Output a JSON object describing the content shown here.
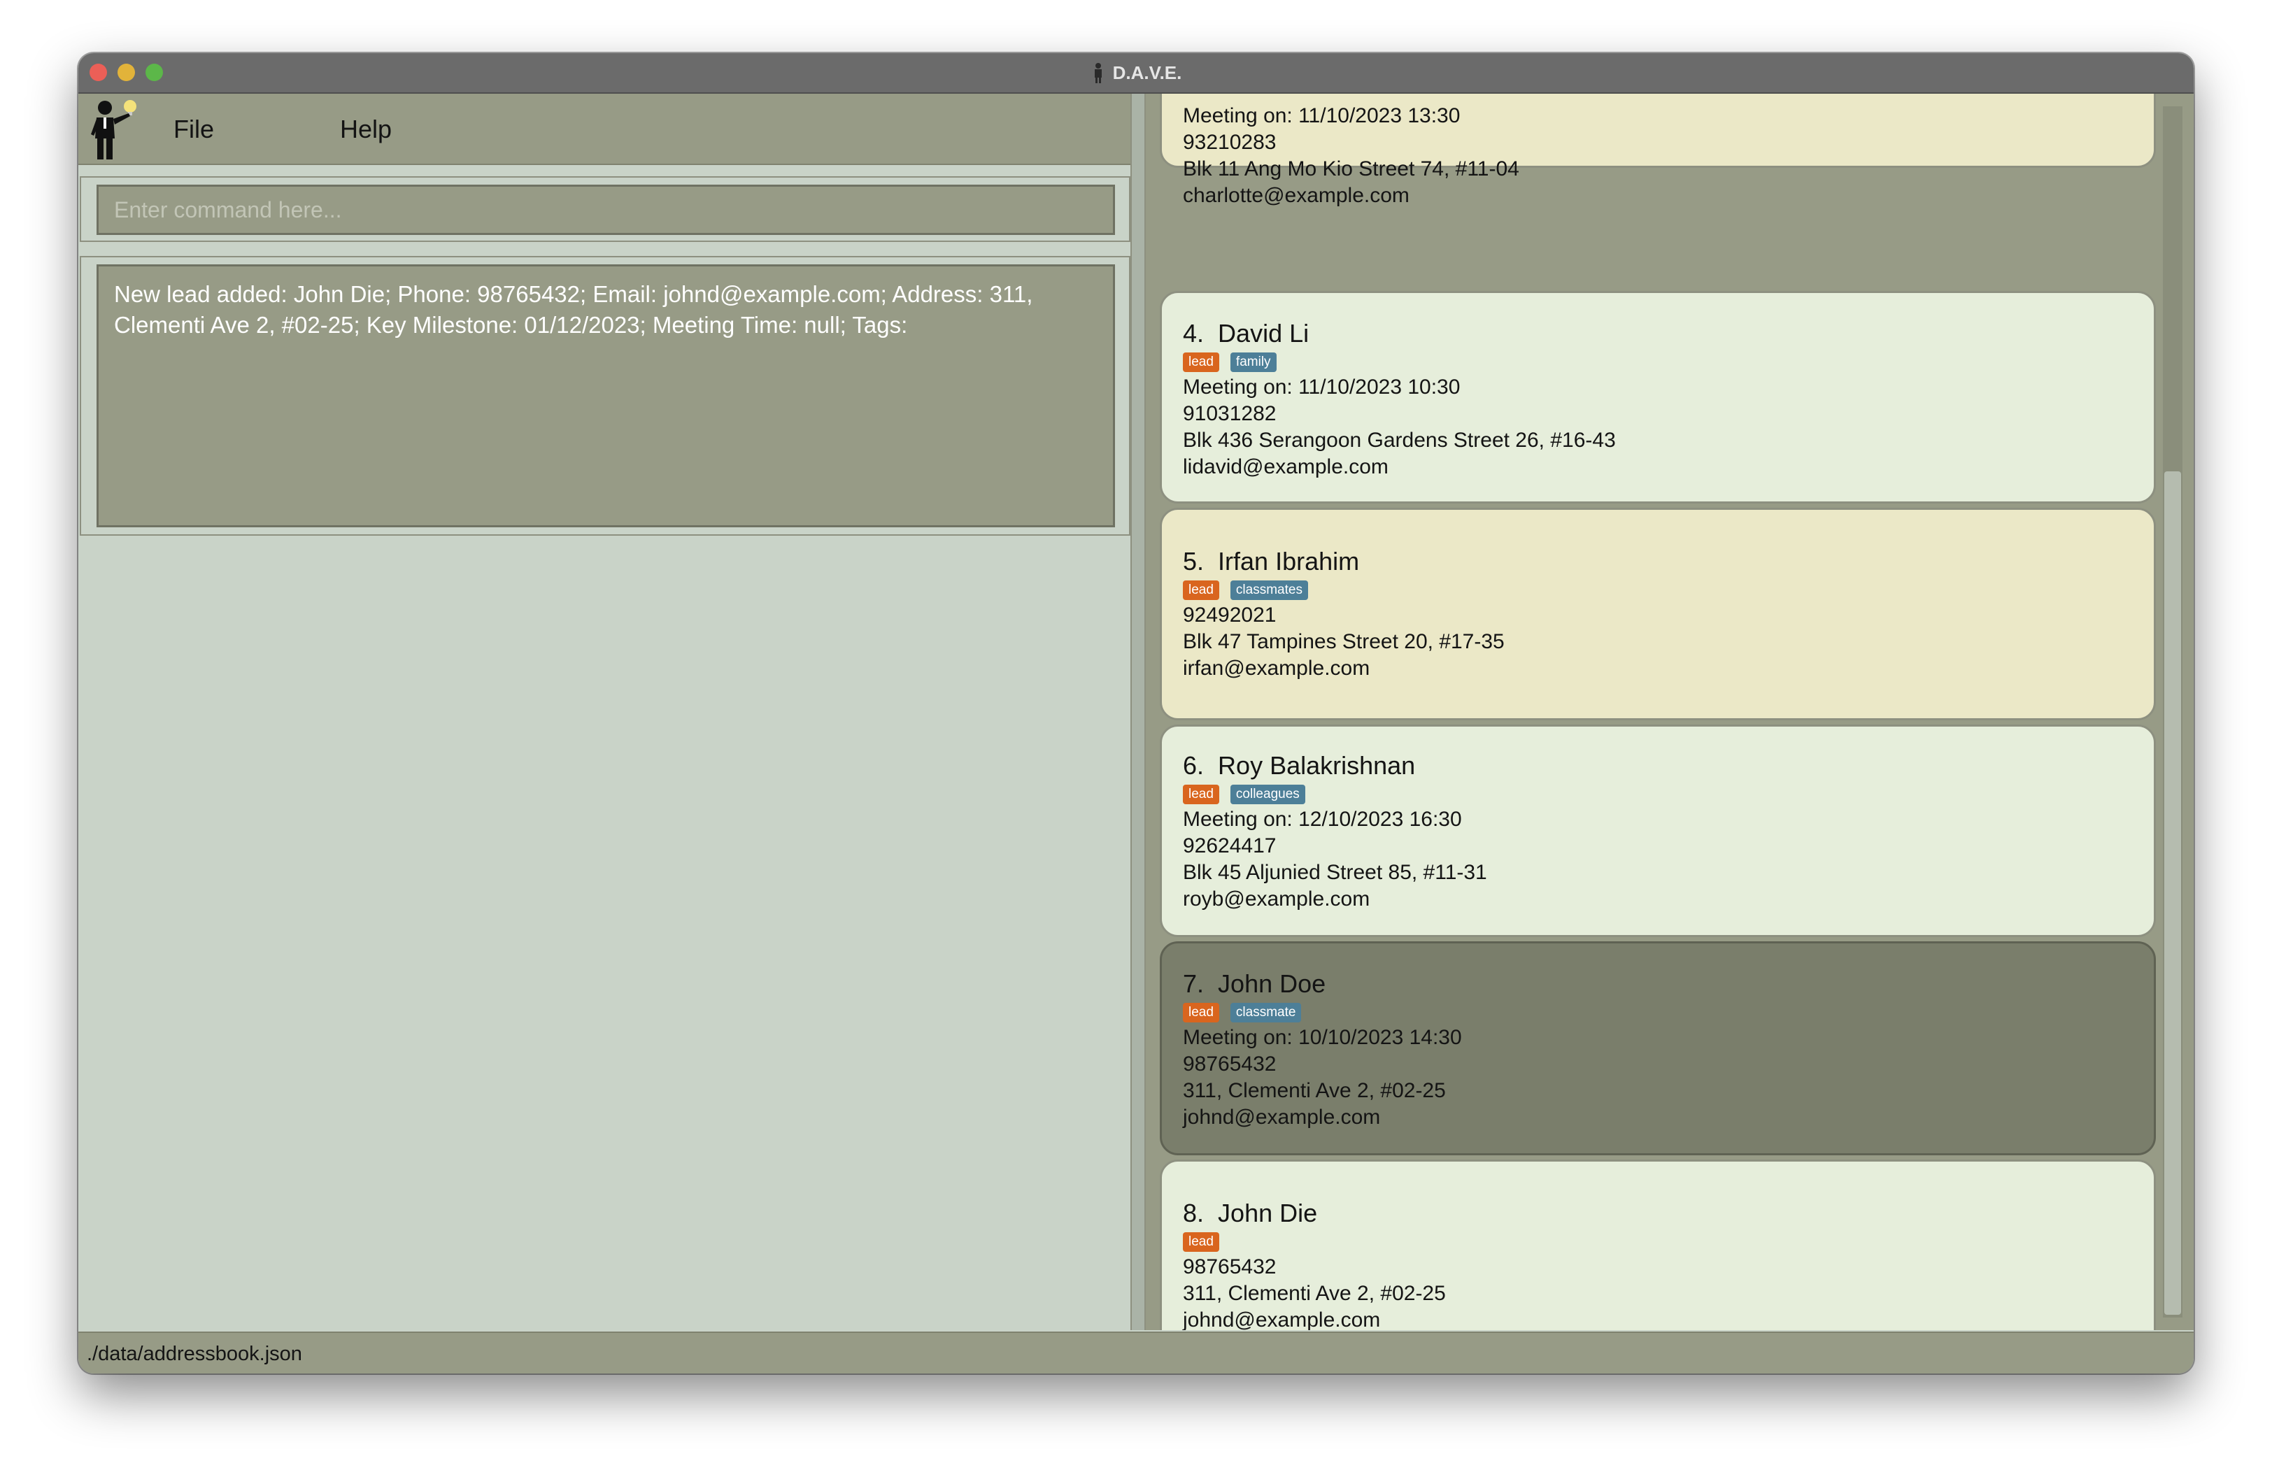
{
  "window": {
    "title": "D.A.V.E."
  },
  "menu": {
    "file": "File",
    "help": "Help"
  },
  "command": {
    "placeholder": "Enter command here..."
  },
  "result": {
    "text": "New lead added: John Die; Phone: 98765432; Email: johnd@example.com; Address: 311, Clementi Ave 2, #02-25; Key Milestone: 01/12/2023; Meeting Time: null; Tags:"
  },
  "status": {
    "path": "./data/addressbook.json"
  },
  "cards": [
    {
      "meeting": "Meeting on: 11/10/2023 13:30",
      "phone": "93210283",
      "address": "Blk 11 Ang Mo Kio Street 74, #11-04",
      "email": "charlotte@example.com"
    },
    {
      "index": "4.",
      "name": "David Li",
      "tags": [
        "lead",
        "family"
      ],
      "meeting": "Meeting on: 11/10/2023 10:30",
      "phone": "91031282",
      "address": "Blk 436 Serangoon Gardens Street 26, #16-43",
      "email": "lidavid@example.com"
    },
    {
      "index": "5.",
      "name": "Irfan Ibrahim",
      "tags": [
        "lead",
        "classmates"
      ],
      "phone": "92492021",
      "address": "Blk 47 Tampines Street 20, #17-35",
      "email": "irfan@example.com"
    },
    {
      "index": "6.",
      "name": "Roy Balakrishnan",
      "tags": [
        "lead",
        "colleagues"
      ],
      "meeting": "Meeting on: 12/10/2023 16:30",
      "phone": "92624417",
      "address": "Blk 45 Aljunied Street 85, #11-31",
      "email": "royb@example.com"
    },
    {
      "index": "7.",
      "name": "John Doe",
      "tags": [
        "lead",
        "classmate"
      ],
      "meeting": "Meeting on: 10/10/2023 14:30",
      "phone": "98765432",
      "address": "311, Clementi Ave 2, #02-25",
      "email": "johnd@example.com"
    },
    {
      "index": "8.",
      "name": "John Die",
      "tags": [
        "lead"
      ],
      "phone": "98765432",
      "address": "311, Clementi Ave 2, #02-25",
      "email": "johnd@example.com"
    }
  ],
  "colors": {
    "lead_tag": "#d9651e",
    "other_tag": "#4d7f98",
    "card_green": "#e6eedb",
    "card_yellow": "#ebe8c7",
    "card_selected": "#7a7e6b"
  }
}
